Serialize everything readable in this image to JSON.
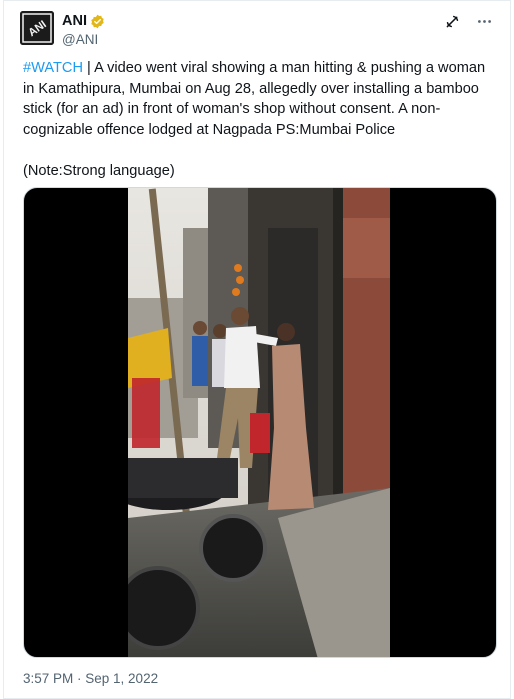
{
  "author": {
    "display_name": "ANI",
    "handle": "@ANI",
    "verified_badge_color": "#e2b719",
    "avatar_icon": "ani-logo-icon"
  },
  "tweet": {
    "hashtag": "#WATCH",
    "body": " | A video went viral showing a man hitting & pushing a woman in Kamathipura, Mumbai on Aug 28, allegedly over installing a bamboo stick (for an ad) in front of woman's shop without consent. A non-cognizable offence lodged at Nagpada PS:Mumbai Police\n\n(Note:Strong language)",
    "hashtag_color": "#1d9bf0"
  },
  "media": {
    "type": "video",
    "background": "#000000"
  },
  "meta": {
    "timestamp": "3:57 PM · Sep 1, 2022"
  },
  "icons": {
    "grok": "grok-icon",
    "more": "more-icon"
  }
}
